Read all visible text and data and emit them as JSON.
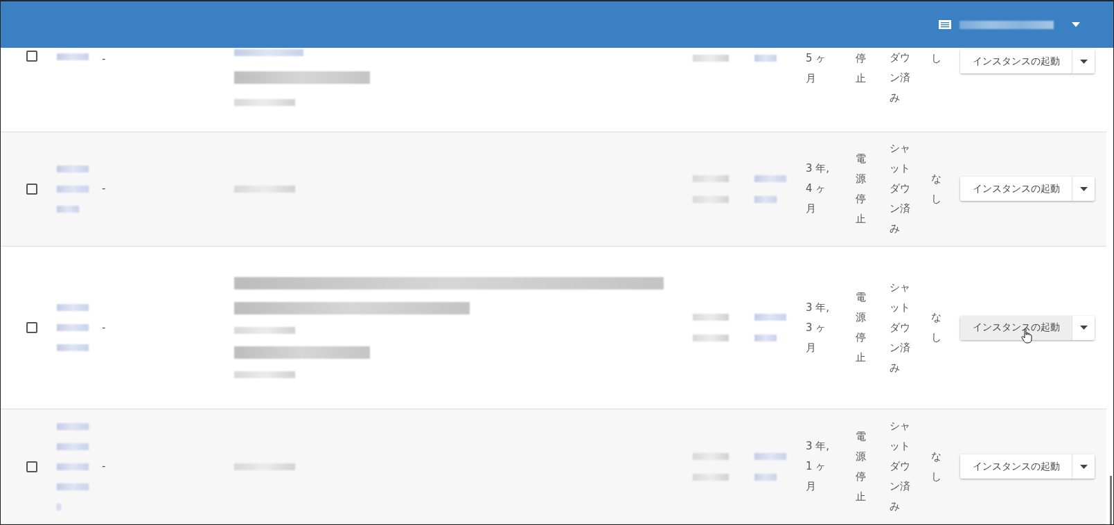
{
  "header": {
    "account": {
      "kind": "blurred"
    }
  },
  "rows": [
    {
      "checked": false,
      "id_lines": [
        {
          "kind": "link"
        }
      ],
      "dash": "-",
      "name_lines": [
        {
          "kind": "linkline"
        },
        {
          "kind": "heading"
        },
        {
          "kind": "note"
        }
      ],
      "col_a": [
        {
          "kind": "plain"
        }
      ],
      "col_b": [
        {
          "kind": "stub"
        }
      ],
      "age": "5 ヶ月",
      "power": "停止",
      "shutdown": "ダウン済み",
      "alarm": "し",
      "action": {
        "label": "インスタンスの起動",
        "hovered": false
      }
    },
    {
      "checked": false,
      "id_lines": [
        {
          "kind": "link"
        },
        {
          "kind": "link"
        },
        {
          "kind": "stub"
        }
      ],
      "dash": "-",
      "name_lines": [
        {
          "kind": "note"
        }
      ],
      "col_a": [
        {
          "kind": "plain"
        },
        {
          "kind": "plain"
        }
      ],
      "col_b": [
        {
          "kind": "link"
        },
        {
          "kind": "stub"
        }
      ],
      "age": "3 年, 4 ヶ月",
      "power": "電源停止",
      "shutdown": "シャットダウン済み",
      "alarm": "なし",
      "action": {
        "label": "インスタンスの起動",
        "hovered": false
      }
    },
    {
      "checked": false,
      "id_lines": [
        {
          "kind": "link"
        },
        {
          "kind": "link"
        },
        {
          "kind": "link"
        }
      ],
      "dash": "-",
      "name_lines": [
        {
          "kind": "banner"
        },
        {
          "kind": "title"
        },
        {
          "kind": "note"
        },
        {
          "kind": "heading"
        },
        {
          "kind": "note"
        }
      ],
      "col_a": [
        {
          "kind": "plain"
        },
        {
          "kind": "plain"
        }
      ],
      "col_b": [
        {
          "kind": "link"
        },
        {
          "kind": "stub"
        }
      ],
      "age": "3 年, 3 ヶ月",
      "power": "電源停止",
      "shutdown": "シャットダウン済み",
      "alarm": "なし",
      "action": {
        "label": "インスタンスの起動",
        "hovered": true
      }
    },
    {
      "checked": false,
      "id_lines": [
        {
          "kind": "link"
        },
        {
          "kind": "link"
        },
        {
          "kind": "link"
        },
        {
          "kind": "link"
        },
        {
          "kind": "dot"
        }
      ],
      "dash": "-",
      "name_lines": [
        {
          "kind": "note"
        }
      ],
      "col_a": [
        {
          "kind": "plain"
        },
        {
          "kind": "plain"
        }
      ],
      "col_b": [
        {
          "kind": "link"
        },
        {
          "kind": "stub"
        }
      ],
      "age": "3 年, 1 ヶ月",
      "power": "電源停止",
      "shutdown": "シャットダウン済み",
      "alarm": "なし",
      "action": {
        "label": "インスタンスの起動",
        "hovered": false
      }
    }
  ]
}
